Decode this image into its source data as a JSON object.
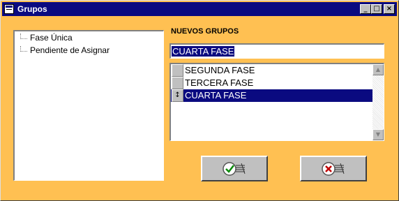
{
  "window": {
    "title": "Grupos"
  },
  "titlebar": {
    "minimize": "_",
    "maximize": "□",
    "close": "×"
  },
  "tree": {
    "items": [
      "Fase Única",
      "Pendiente de Asignar"
    ]
  },
  "form": {
    "label": "NUEVOS GRUPOS",
    "input_value": "CUARTA FASE",
    "list": [
      {
        "label": "SEGUNDA FASE",
        "handle": ""
      },
      {
        "label": "TERCERA FASE",
        "handle": ""
      },
      {
        "label": "CUARTA FASE",
        "handle": "↕",
        "selected": true
      }
    ]
  },
  "scrollbar": {
    "up": "▲",
    "down": "▼"
  },
  "actions": {
    "accept_icon": "check-icon",
    "cancel_icon": "x-icon"
  },
  "colors": {
    "background": "#ffc052",
    "titlebar": "#0a0a80",
    "selection": "#0a0a80"
  }
}
